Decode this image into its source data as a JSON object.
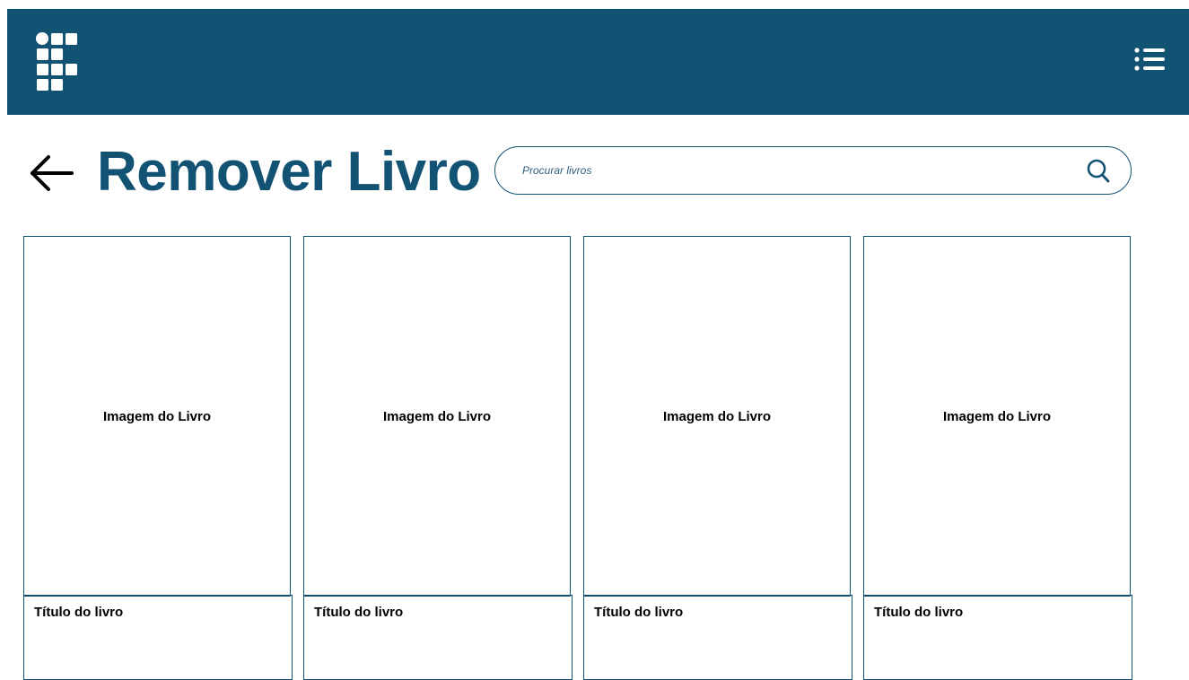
{
  "header": {
    "logo_icon": "grid-logo-icon",
    "menu_icon": "list-menu-icon",
    "background_color": "#125273"
  },
  "page": {
    "back_icon": "arrow-left-icon",
    "title": "Remover Livro",
    "accent_color": "#125273"
  },
  "search": {
    "placeholder": "Procurar livros",
    "value": "",
    "icon": "search-icon"
  },
  "books": [
    {
      "image_label": "Imagem do Livro",
      "title": "Título do livro"
    },
    {
      "image_label": "Imagem do Livro",
      "title": "Título do livro"
    },
    {
      "image_label": "Imagem do Livro",
      "title": "Título do livro"
    },
    {
      "image_label": "Imagem do Livro",
      "title": "Título do livro"
    }
  ]
}
